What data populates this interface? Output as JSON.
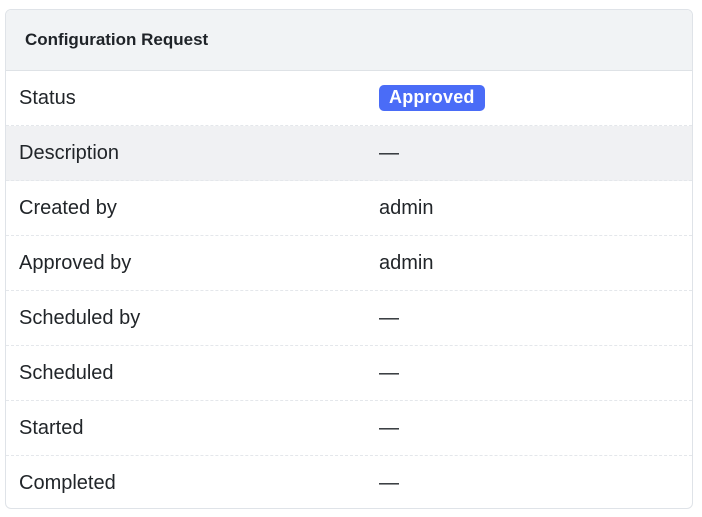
{
  "card": {
    "title": "Configuration Request"
  },
  "rows": [
    {
      "label": "Status",
      "value": "Approved",
      "kind": "badge"
    },
    {
      "label": "Description",
      "value": "—",
      "kind": "muted"
    },
    {
      "label": "Created by",
      "value": "admin",
      "kind": "text"
    },
    {
      "label": "Approved by",
      "value": "admin",
      "kind": "text"
    },
    {
      "label": "Scheduled by",
      "value": "—",
      "kind": "dark"
    },
    {
      "label": "Scheduled",
      "value": "—",
      "kind": "muted"
    },
    {
      "label": "Started",
      "value": "—",
      "kind": "muted"
    },
    {
      "label": "Completed",
      "value": "—",
      "kind": "muted"
    }
  ],
  "colors": {
    "badge_bg": "#4a6cf7",
    "header_bg": "#f1f3f5",
    "highlight_row_bg": "#f0f1f3"
  }
}
